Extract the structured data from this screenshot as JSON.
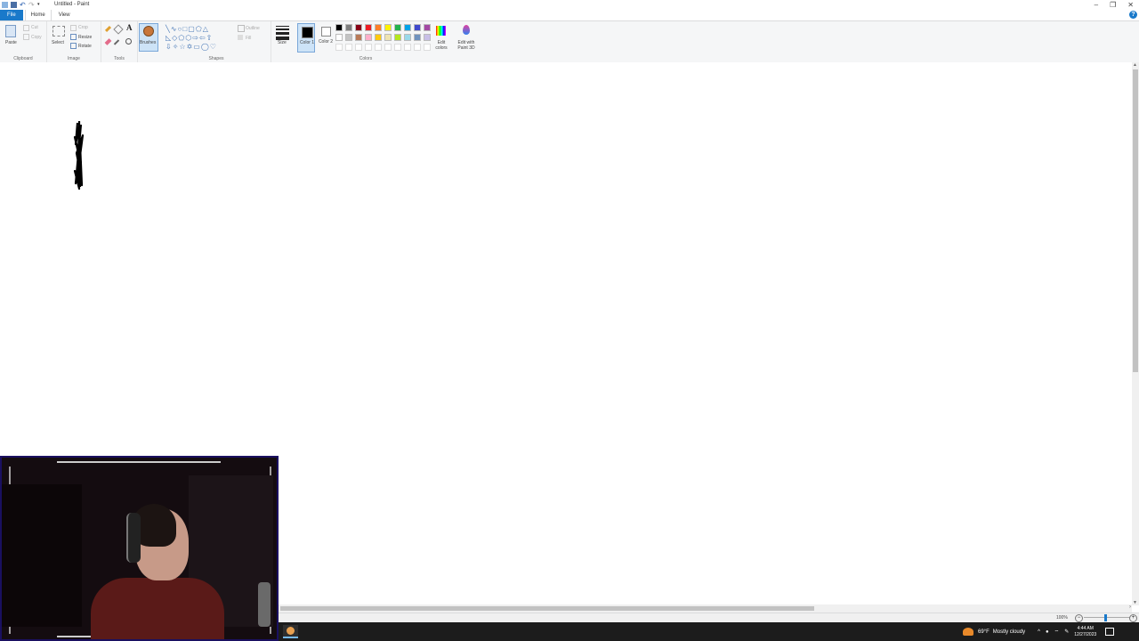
{
  "window": {
    "title": "Untitled - Paint",
    "minimize": "–",
    "restore": "❐",
    "close": "✕"
  },
  "tabs": [
    {
      "label": "File"
    },
    {
      "label": "Home"
    },
    {
      "label": "View"
    }
  ],
  "help": "?",
  "ribbon": {
    "clipboard": {
      "group_label": "Clipboard",
      "paste": "Paste",
      "cut": "Cut",
      "copy": "Copy"
    },
    "image": {
      "group_label": "Image",
      "select": "Select",
      "crop": "Crop",
      "resize": "Resize",
      "rotate": "Rotate"
    },
    "tools": {
      "group_label": "Tools",
      "text_tool": "A"
    },
    "brushes": {
      "label": "Brushes"
    },
    "shapes": {
      "group_label": "Shapes",
      "outline": "Outline",
      "fill": "Fill"
    },
    "size": {
      "label": "Size"
    },
    "colors": {
      "group_label": "Colors",
      "color1_label": "Color 1",
      "color1_value": "#000000",
      "color2_label": "Color 2",
      "color2_value": "#ffffff",
      "edit_colors": "Edit colors",
      "edit_paint3d": "Edit with Paint 3D",
      "palette_row1": [
        "#000000",
        "#7f7f7f",
        "#880015",
        "#ed1c24",
        "#ff7f27",
        "#fff200",
        "#22b14c",
        "#00a2e8",
        "#3f48cc",
        "#a349a4"
      ],
      "palette_row2": [
        "#ffffff",
        "#c3c3c3",
        "#b97a57",
        "#ffaec9",
        "#ffc90e",
        "#efe4b0",
        "#b5e61d",
        "#99d9ea",
        "#7092be",
        "#c8bfe7"
      ],
      "palette_row3": [
        "#ffffff",
        "#ffffff",
        "#ffffff",
        "#ffffff",
        "#ffffff",
        "#ffffff",
        "#ffffff",
        "#ffffff",
        "#ffffff",
        "#ffffff"
      ]
    }
  },
  "statusbar": {
    "zoom": "100%"
  },
  "taskbar": {
    "weather_temp": "69°F",
    "weather_desc": "Mostly cloudy",
    "time": "4:44 AM",
    "date": "12/27/2023"
  }
}
